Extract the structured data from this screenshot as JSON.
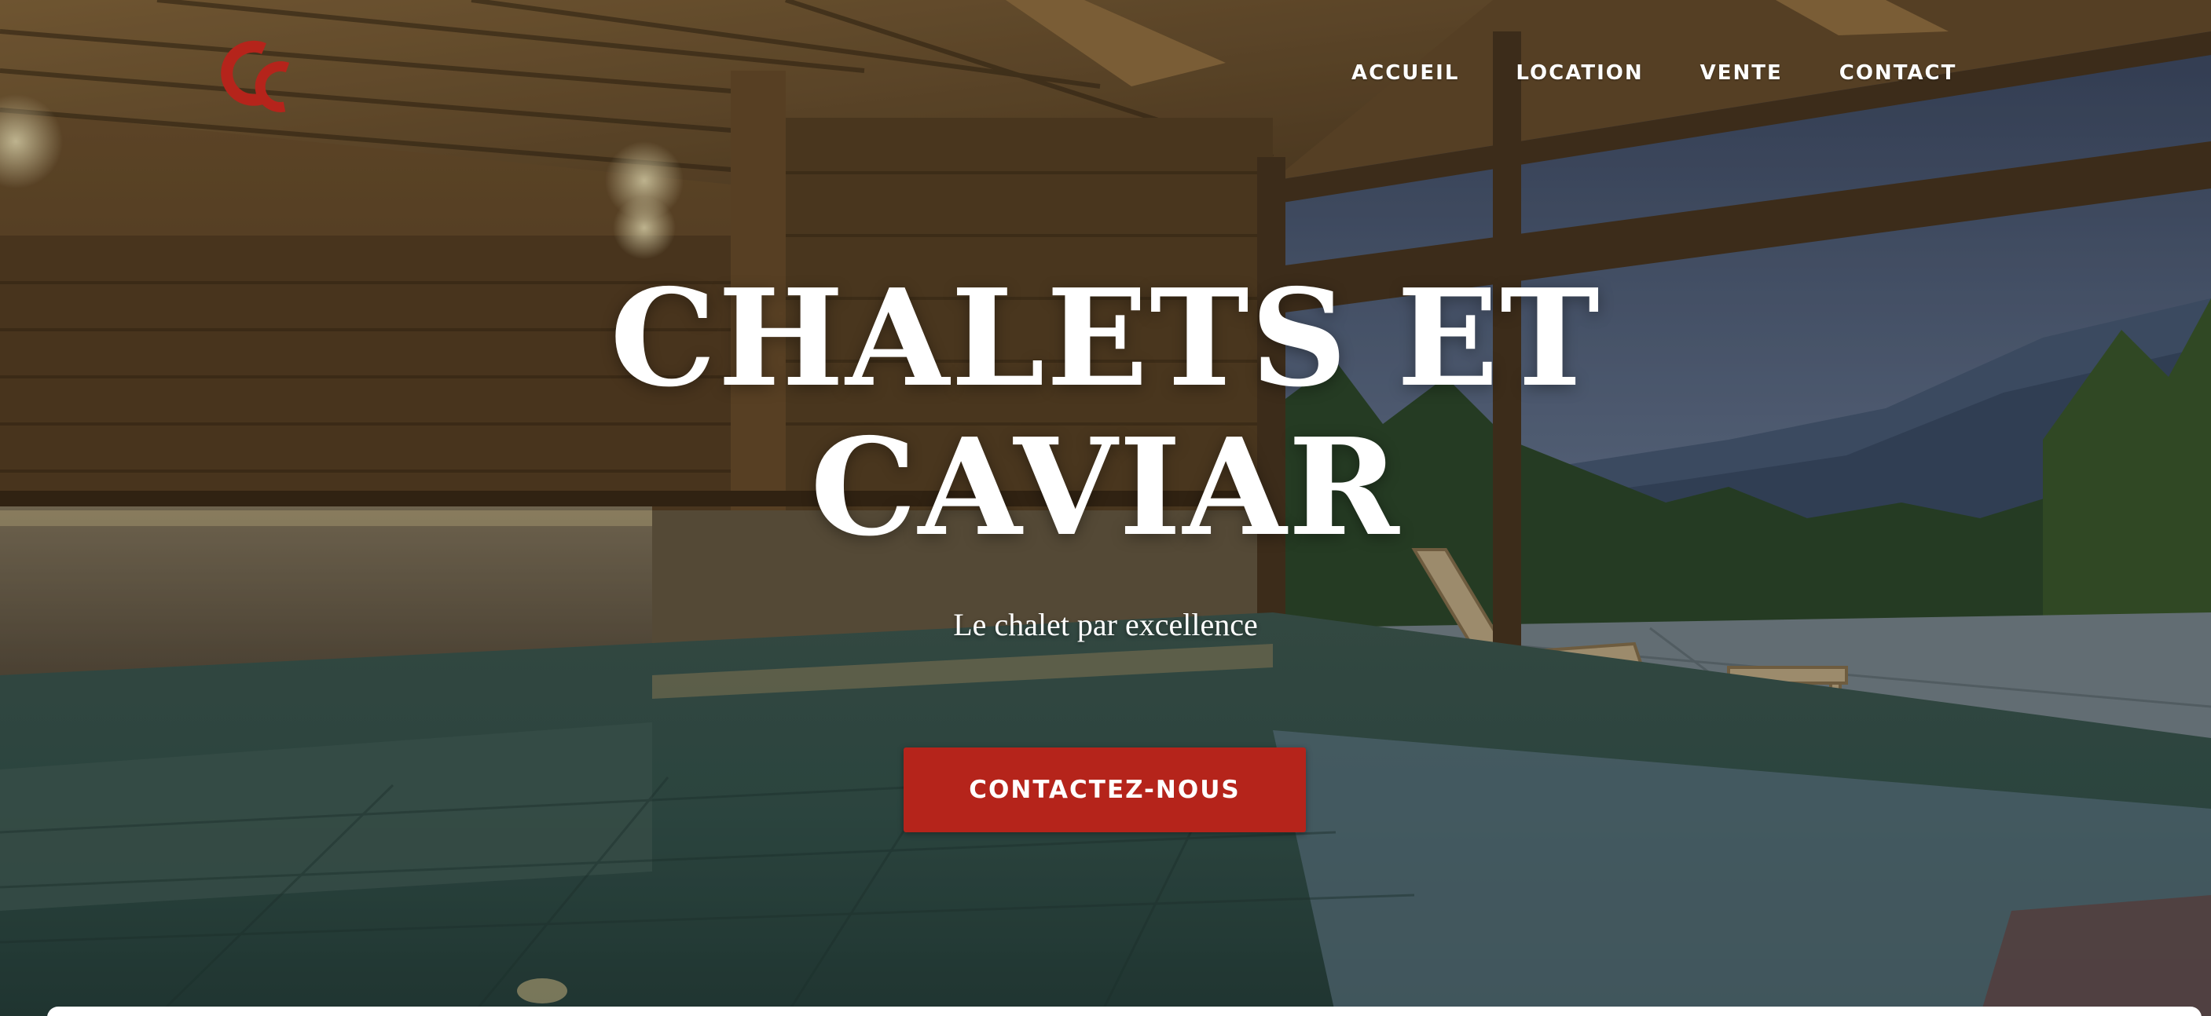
{
  "brand": {
    "logo_icon": "cc-monogram-logo",
    "accent_color": "#b5241b"
  },
  "nav": {
    "items": [
      {
        "label": "ACCUEIL"
      },
      {
        "label": "LOCATION"
      },
      {
        "label": "VENTE"
      },
      {
        "label": "CONTACT"
      }
    ]
  },
  "hero": {
    "title_line1": "CHALETS ET",
    "title_line2": "CAVIAR",
    "subtitle": "Le chalet par excellence",
    "cta_label": "CONTACTEZ-NOUS",
    "background": "indoor pool chalet with mountain view"
  }
}
